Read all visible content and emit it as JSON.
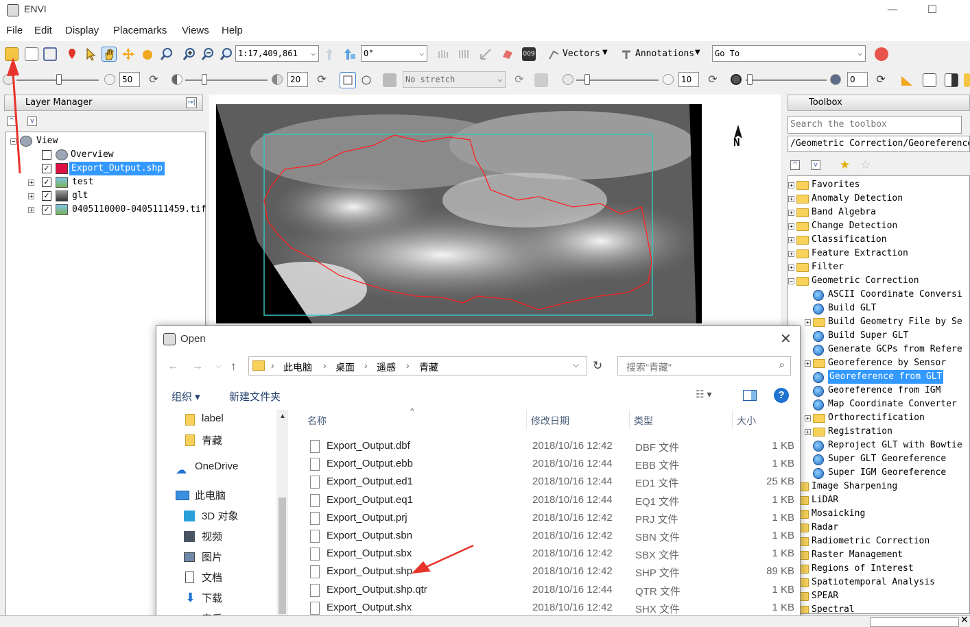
{
  "window": {
    "title": "ENVI",
    "minimize": "—",
    "maximize": "☐"
  },
  "menu": [
    "File",
    "Edit",
    "Display",
    "Placemarks",
    "Views",
    "Help"
  ],
  "toolbar1": {
    "scale_value": "1:17,409,861",
    "rotation_value": "0°",
    "vectors_label": "Vectors",
    "annotations_label": "Annotations",
    "goto_value": "Go To"
  },
  "toolbar2": {
    "brightness": "50",
    "contrast": "20",
    "stretch": "No stretch",
    "sharpen": "10",
    "transparency": "0"
  },
  "layer_manager": {
    "title": "Layer Manager",
    "root": "View",
    "layers": [
      {
        "name": "Overview",
        "checked": false
      },
      {
        "name": "Export_Output.shp",
        "checked": true,
        "selected": true
      },
      {
        "name": "test",
        "checked": true
      },
      {
        "name": "glt",
        "checked": true
      },
      {
        "name": "0405110000-0405111459.tif",
        "checked": true
      }
    ]
  },
  "north_arrow": "N",
  "toolbox": {
    "title": "Toolbox",
    "search_placeholder": "Search the toolbox",
    "path": "/Geometric Correction/Georeference",
    "items": [
      {
        "label": "Favorites",
        "kind": "folder",
        "level": 0
      },
      {
        "label": "Anomaly Detection",
        "kind": "folder",
        "level": 0
      },
      {
        "label": "Band Algebra",
        "kind": "folder",
        "level": 0
      },
      {
        "label": "Change Detection",
        "kind": "folder",
        "level": 0
      },
      {
        "label": "Classification",
        "kind": "folder",
        "level": 0
      },
      {
        "label": "Feature Extraction",
        "kind": "folder",
        "level": 0
      },
      {
        "label": "Filter",
        "kind": "folder",
        "level": 0
      },
      {
        "label": "Geometric Correction",
        "kind": "folder",
        "level": 0,
        "open": true
      },
      {
        "label": "ASCII Coordinate Conversi",
        "kind": "tool",
        "level": 1
      },
      {
        "label": "Build GLT",
        "kind": "tool",
        "level": 1
      },
      {
        "label": "Build Geometry File by Se",
        "kind": "folder",
        "level": 1
      },
      {
        "label": "Build Super GLT",
        "kind": "tool",
        "level": 1
      },
      {
        "label": "Generate GCPs from Refere",
        "kind": "tool",
        "level": 1
      },
      {
        "label": "Georeference by Sensor",
        "kind": "folder",
        "level": 1
      },
      {
        "label": "Georeference from GLT",
        "kind": "tool",
        "level": 1,
        "selected": true
      },
      {
        "label": "Georeference from IGM",
        "kind": "tool",
        "level": 1
      },
      {
        "label": "Map Coordinate Converter",
        "kind": "tool",
        "level": 1
      },
      {
        "label": "Orthorectification",
        "kind": "folder",
        "level": 1
      },
      {
        "label": "Registration",
        "kind": "folder",
        "level": 1
      },
      {
        "label": "Reproject GLT with Bowtie",
        "kind": "tool",
        "level": 1
      },
      {
        "label": "Super GLT Georeference",
        "kind": "tool",
        "level": 1
      },
      {
        "label": "Super IGM Georeference",
        "kind": "tool",
        "level": 1
      },
      {
        "label": "Image Sharpening",
        "kind": "folder",
        "level": 0
      },
      {
        "label": "LiDAR",
        "kind": "folder",
        "level": 0
      },
      {
        "label": "Mosaicking",
        "kind": "folder",
        "level": 0
      },
      {
        "label": "Radar",
        "kind": "folder",
        "level": 0
      },
      {
        "label": "Radiometric Correction",
        "kind": "folder",
        "level": 0
      },
      {
        "label": "Raster Management",
        "kind": "folder",
        "level": 0
      },
      {
        "label": "Regions of Interest",
        "kind": "folder",
        "level": 0
      },
      {
        "label": "Spatiotemporal Analysis",
        "kind": "folder",
        "level": 0
      },
      {
        "label": "SPEAR",
        "kind": "folder",
        "level": 0
      },
      {
        "label": "Spectral",
        "kind": "folder",
        "level": 0
      }
    ]
  },
  "dialog": {
    "title": "Open",
    "breadcrumb": [
      "此电脑",
      "桌面",
      "遥感",
      "青藏"
    ],
    "search_placeholder": "搜索\"青藏\"",
    "organize": "组织 ▾",
    "new_folder": "新建文件夹",
    "nav": [
      {
        "label": "label",
        "icon": "folder"
      },
      {
        "label": "青藏",
        "icon": "folder"
      },
      {
        "label": "OneDrive",
        "icon": "cloud"
      },
      {
        "label": "此电脑",
        "icon": "computer"
      },
      {
        "label": "3D 对象",
        "icon": "cube"
      },
      {
        "label": "视频",
        "icon": "video"
      },
      {
        "label": "图片",
        "icon": "picture"
      },
      {
        "label": "文档",
        "icon": "document"
      },
      {
        "label": "下载",
        "icon": "download"
      },
      {
        "label": "音乐",
        "icon": "music"
      }
    ],
    "columns": [
      "名称",
      "修改日期",
      "类型",
      "大小"
    ],
    "files": [
      {
        "name": "Export_Output.dbf",
        "date": "2018/10/16 12:42",
        "type": "DBF 文件",
        "size": "1 KB"
      },
      {
        "name": "Export_Output.ebb",
        "date": "2018/10/16 12:44",
        "type": "EBB 文件",
        "size": "1 KB"
      },
      {
        "name": "Export_Output.ed1",
        "date": "2018/10/16 12:44",
        "type": "ED1 文件",
        "size": "25 KB"
      },
      {
        "name": "Export_Output.eq1",
        "date": "2018/10/16 12:44",
        "type": "EQ1 文件",
        "size": "1 KB"
      },
      {
        "name": "Export_Output.prj",
        "date": "2018/10/16 12:42",
        "type": "PRJ 文件",
        "size": "1 KB"
      },
      {
        "name": "Export_Output.sbn",
        "date": "2018/10/16 12:42",
        "type": "SBN 文件",
        "size": "1 KB"
      },
      {
        "name": "Export_Output.sbx",
        "date": "2018/10/16 12:42",
        "type": "SBX 文件",
        "size": "1 KB"
      },
      {
        "name": "Export_Output.shp",
        "date": "2018/10/16 12:42",
        "type": "SHP 文件",
        "size": "89 KB"
      },
      {
        "name": "Export_Output.shp.qtr",
        "date": "2018/10/16 12:44",
        "type": "QTR 文件",
        "size": "1 KB"
      },
      {
        "name": "Export_Output.shx",
        "date": "2018/10/16 12:42",
        "type": "SHX 文件",
        "size": "1 KB"
      }
    ]
  },
  "colors": {
    "selection": "#3399ff",
    "annotation_arrow": "#e8322c",
    "boundary": "#ff2020",
    "extent_box": "#35c6c0",
    "help": "#1f73d1"
  }
}
